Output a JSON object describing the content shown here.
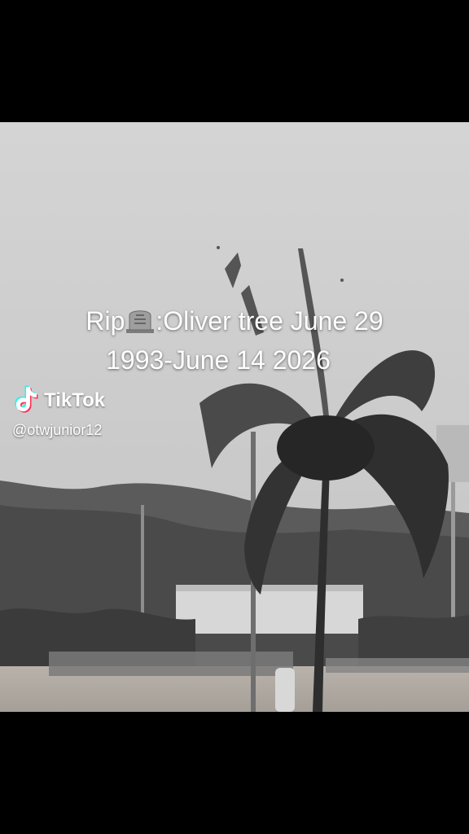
{
  "caption": {
    "line1_prefix": "Rip",
    "line1_suffix": ":Oliver tree June 29",
    "line2": "1993-June 14 2026",
    "emoji": "headstone-icon"
  },
  "watermark": {
    "brand": "TikTok",
    "handle": "@otwjunior12"
  },
  "colors": {
    "sky": "#cfcfcf",
    "letterbox": "#000000",
    "text": "#ffffff"
  }
}
